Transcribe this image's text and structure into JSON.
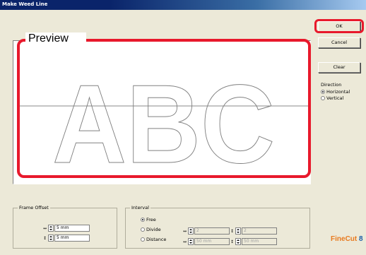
{
  "window": {
    "title": "Make Weed Line"
  },
  "buttons": {
    "ok": "OK",
    "cancel": "Cancel",
    "clear": "Clear"
  },
  "preview": {
    "label": "Preview",
    "text": "ABC"
  },
  "direction": {
    "title": "Direction",
    "options": [
      {
        "label": "Horizontal",
        "selected": true
      },
      {
        "label": "Vertical",
        "selected": false
      }
    ]
  },
  "frame_offset": {
    "title": "Frame Offset",
    "horizontal": {
      "value": "5 mm",
      "icon": "horizontal-arrow-icon"
    },
    "vertical": {
      "value": "5 mm",
      "icon": "vertical-arrow-icon"
    }
  },
  "interval": {
    "title": "Interval",
    "options": [
      {
        "label": "Free",
        "selected": true
      },
      {
        "label": "Divide",
        "selected": false
      },
      {
        "label": "Distance",
        "selected": false
      }
    ],
    "divide": {
      "h_value": "2",
      "v_value": "2"
    },
    "distance": {
      "h_value": "50 mm",
      "v_value": "50 mm"
    }
  },
  "logo": {
    "text_fine": "Fine",
    "text_cut": "Cut",
    "mark": "8"
  },
  "colors": {
    "highlight": "#e8192c",
    "titlebar": "#0a246a",
    "logo_orange": "#e87a1f",
    "logo_blue": "#1b5fa8"
  }
}
